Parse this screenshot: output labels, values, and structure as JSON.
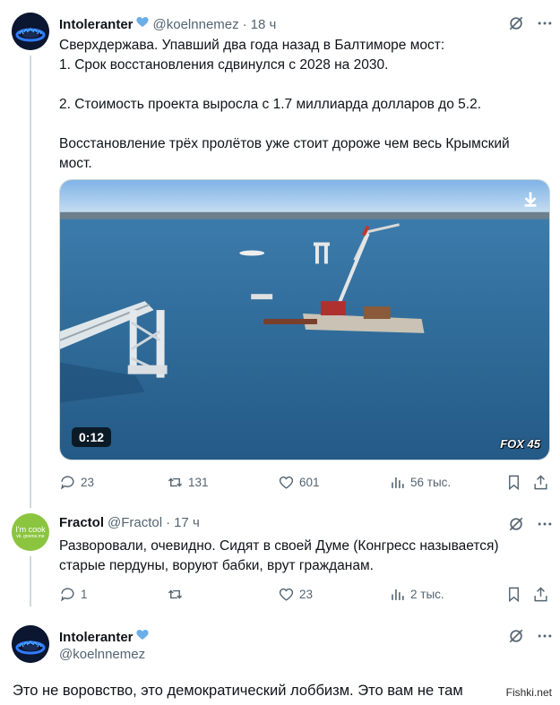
{
  "tweet1": {
    "name": "Intoleranter",
    "handle": "@koelnnemez",
    "dot": "·",
    "time": "18 ч",
    "lines": [
      "Сверхдержава. Упавший два года назад в Балтиморе мост:",
      "1. Срок восстановления сдвинулся с 2028 на 2030.",
      "",
      "2. Стоимость проекта выросла с 1.7 миллиарда долларов до 5.2.",
      "",
      "Восстановление трёх пролётов уже стоит дороже чем весь Крымский",
      "мост."
    ],
    "video_duration": "0:12",
    "video_watermark": "FOX 45",
    "replies": "23",
    "retweets": "131",
    "likes": "601",
    "views": "56 тыс."
  },
  "tweet2": {
    "name": "Fractol",
    "handle": "@Fractol",
    "dot": "·",
    "time": "17 ч",
    "avatar_text_1": "I'm cook",
    "avatar_text_2": "vk. gnome.me",
    "lines": [
      "Разворовали, очевидно. Сидят в своей Думе (Конгресс называется)",
      "старые пердуны, воруют бабки, врут гражданам."
    ],
    "replies": "1",
    "retweets": "",
    "likes": "23",
    "views": "2 тыс."
  },
  "tweet3": {
    "name": "Intoleranter",
    "handle": "@koelnnemez",
    "text": "Это не воровство, это демократический лоббизм. Это вам не там"
  },
  "site_watermark": "Fishki.net",
  "colors": {
    "text": "#0f1419",
    "muted": "#536471",
    "verified": "#6aaee8",
    "thread_line": "#cfd9de",
    "water": "#2f6e9e"
  },
  "icons": [
    "verified-icon",
    "grok-icon",
    "more-icon",
    "reply-icon",
    "retweet-icon",
    "like-icon",
    "views-icon",
    "bookmark-icon",
    "share-icon",
    "download-icon"
  ]
}
